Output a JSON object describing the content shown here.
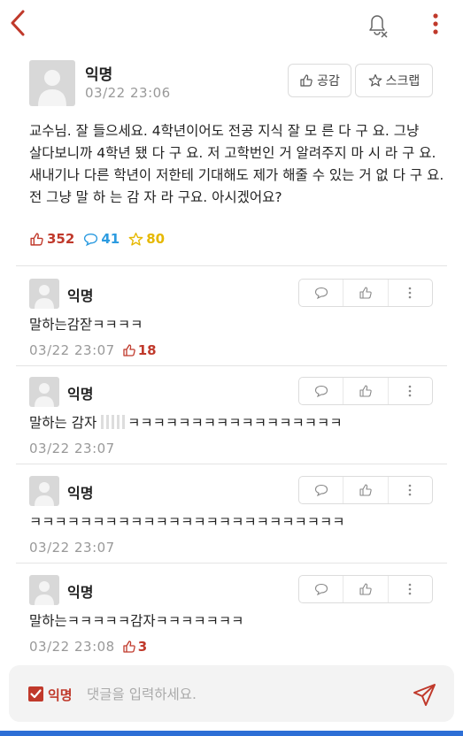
{
  "colors": {
    "accent": "#c0392b",
    "comment_blue": "#2c9be0",
    "scrap_yellow": "#e6b800",
    "muted": "#999999"
  },
  "icons": {
    "back": "chevron-left-icon",
    "bell": "bell-off-icon",
    "more": "vertical-dots-icon"
  },
  "post": {
    "author": "익명",
    "time": "03/22 23:06",
    "like_button": "공감",
    "scrap_button": "스크랩",
    "body": "교수님. 잘 들으세요. 4학년이어도 전공 지식 잘 모 른 다 구 요. 그냥 살다보니까 4학년 됐 다 구 요. 저 고학번인 거 알려주지 마 시 라 구 요. 새내기나 다른 학년이 저한테 기대해도 제가 해줄 수 있는 거 없 다 구 요. 전 그냥 말 하 는 감 자 라 구요. 아시겠어요?",
    "likes": "352",
    "comments": "41",
    "scraps": "80"
  },
  "comments": [
    {
      "author": "익명",
      "text": "말하는감잗ㅋㅋㅋㅋ",
      "time": "03/22 23:07",
      "likes": "18"
    },
    {
      "author": "익명",
      "text_before": "말하는 감자 ",
      "text_after": "ㅋㅋㅋㅋㅋㅋㅋㅋㅋㅋㅋㅋㅋㅋㅋㅋㅋ",
      "time": "03/22 23:07"
    },
    {
      "author": "익명",
      "text": "ㅋㅋㅋㅋㅋㅋㅋㅋㅋㅋㅋㅋㅋㅋㅋㅋㅋㅋㅋㅋㅋㅋㅋㅋㅋ",
      "time": "03/22 23:07"
    },
    {
      "author": "익명",
      "text": "말하는ㅋㅋㅋㅋㅋ감자ㅋㅋㅋㅋㅋㅋㅋ",
      "time": "03/22 23:08",
      "likes": "3"
    }
  ],
  "input": {
    "anon_label": "익명",
    "placeholder": "댓글을 입력하세요."
  }
}
